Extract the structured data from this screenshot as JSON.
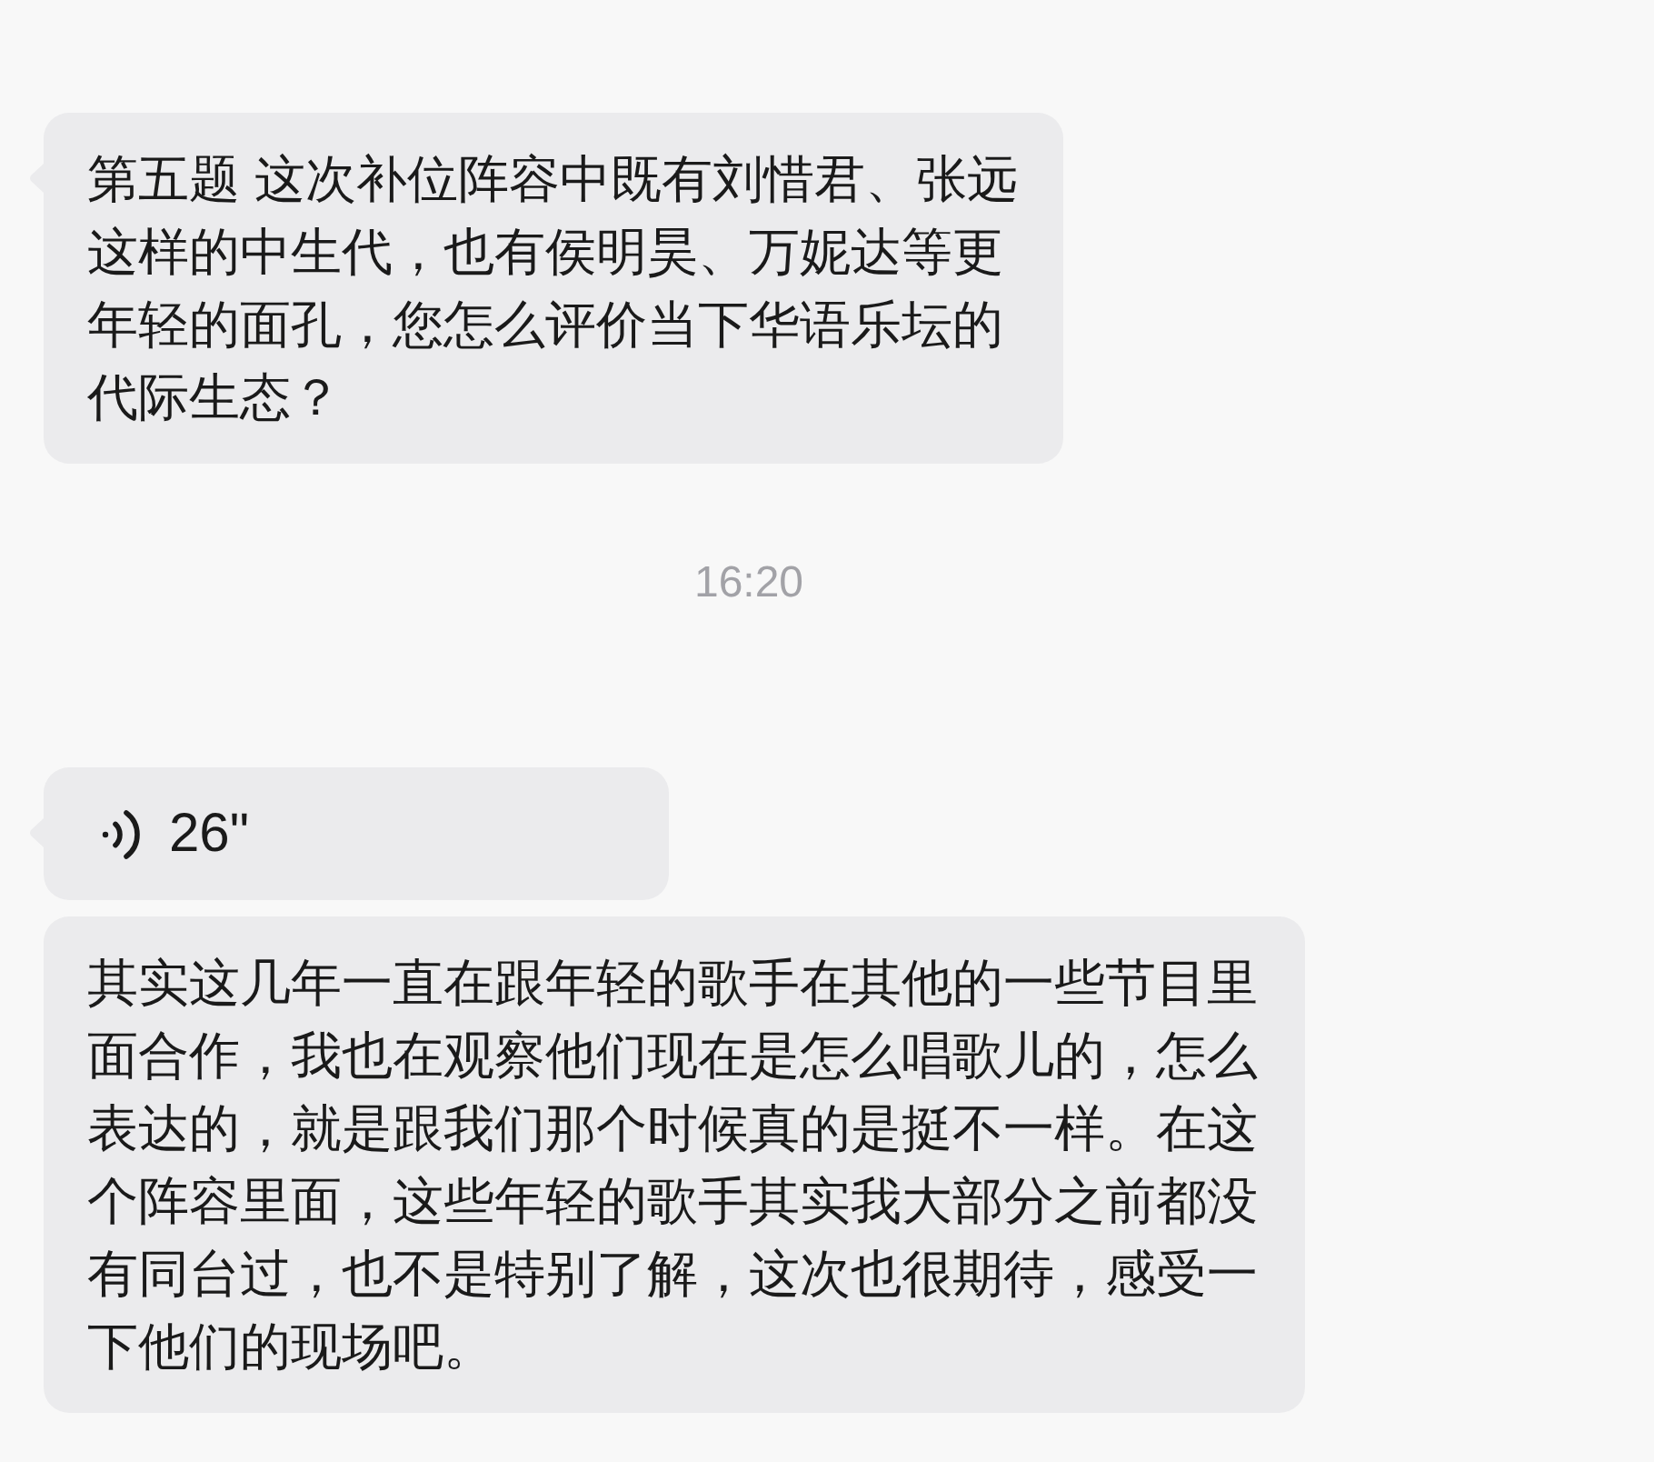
{
  "messages": [
    {
      "kind": "text",
      "tail": true,
      "text": "第五题 这次补位阵容中既有刘惜君、张远这样的中生代，也有侯明昊、万妮达等更年轻的面孔，您怎么评价当下华语乐坛的代际生态？"
    },
    {
      "kind": "time",
      "text": "16:20"
    },
    {
      "kind": "voice",
      "tail": true,
      "duration": "26\""
    },
    {
      "kind": "text",
      "tail": false,
      "text": "其实这几年一直在跟年轻的歌手在其他的一些节目里面合作，我也在观察他们现在是怎么唱歌儿的，怎么表达的，就是跟我们那个时候真的是挺不一样。在这个阵容里面，这些年轻的歌手其实我大部分之前都没有同台过，也不是特别了解，这次也很期待，感受一下他们的现场吧。"
    }
  ]
}
